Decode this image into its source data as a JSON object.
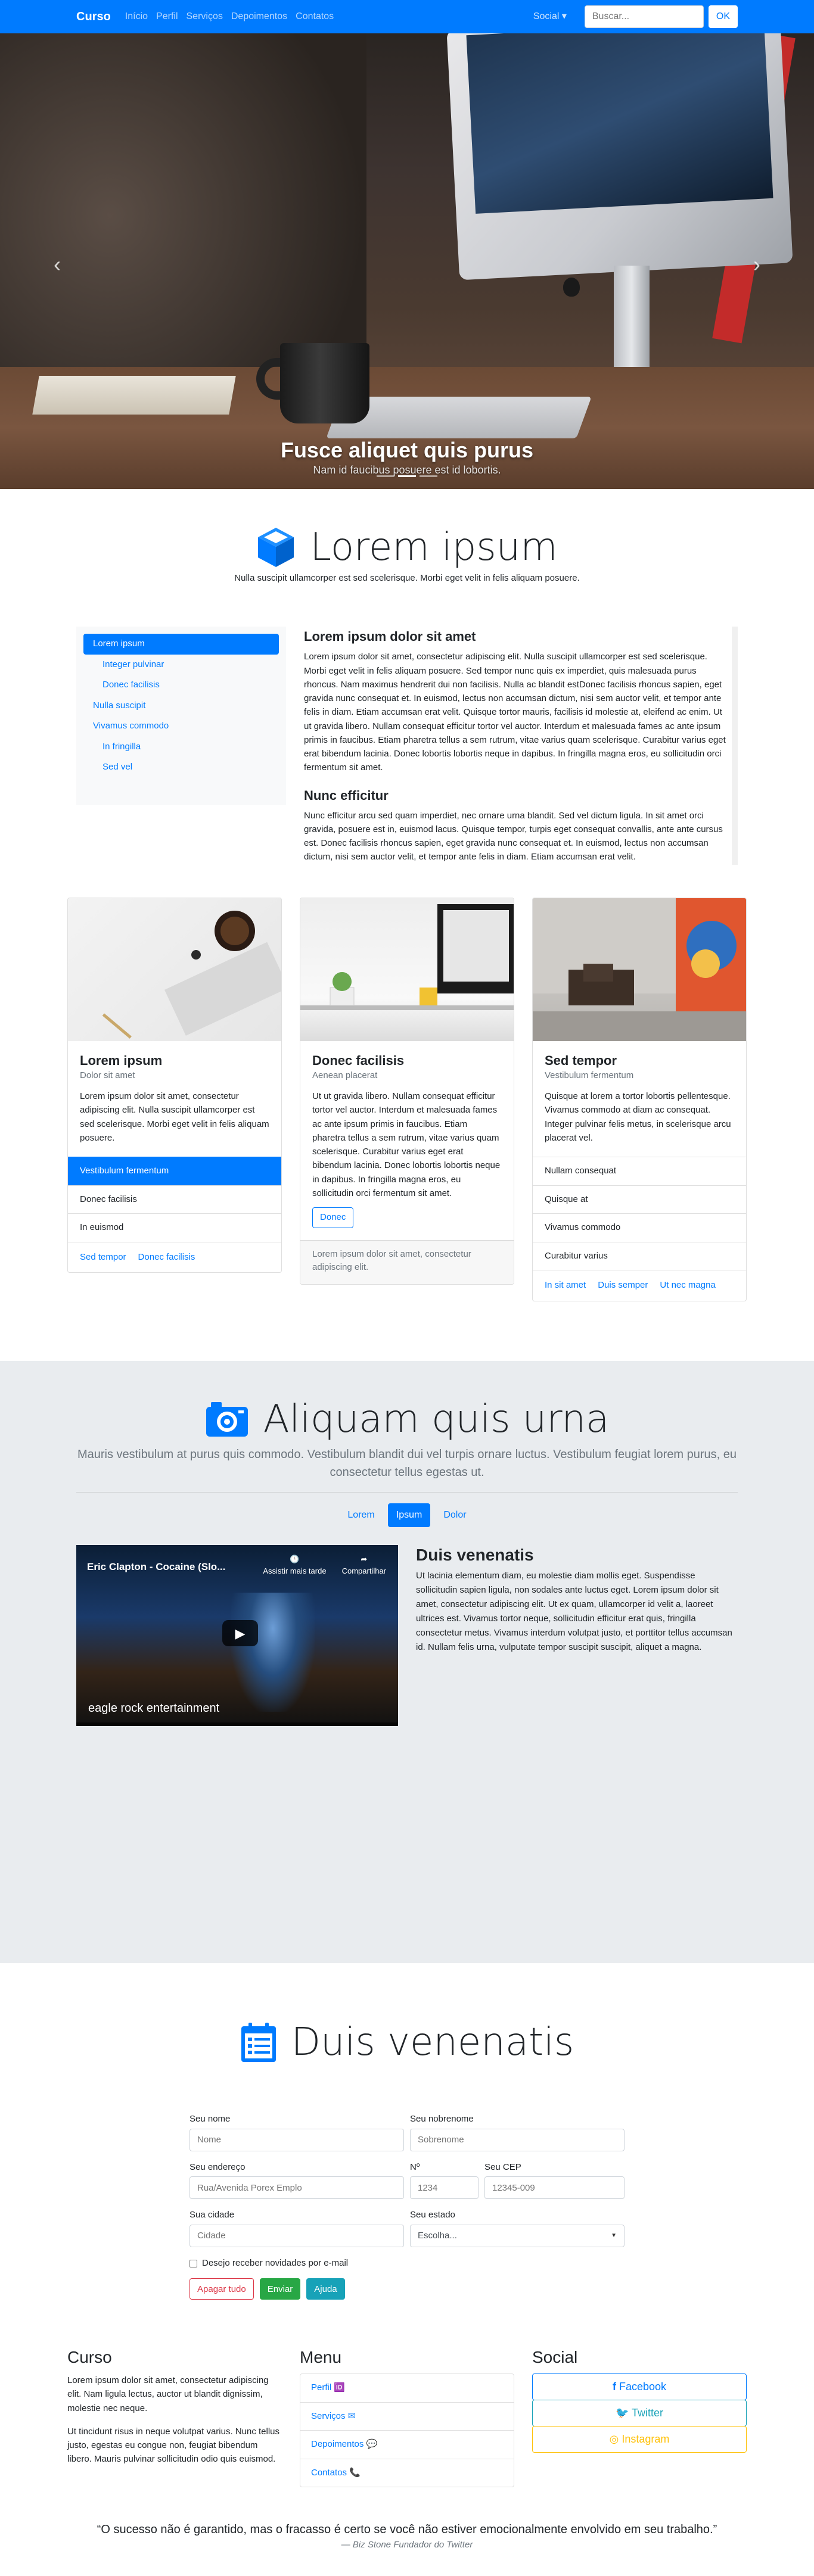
{
  "navbar": {
    "brand": "Curso",
    "links": [
      "Início",
      "Perfil",
      "Serviços",
      "Depoimentos",
      "Contatos"
    ],
    "social": "Social ▾",
    "search_placeholder": "Buscar...",
    "ok": "OK"
  },
  "hero": {
    "title": "Fusce aliquet quis purus",
    "subtitle": "Nam id faucibus posuere est id lobortis."
  },
  "intro": {
    "title": "Lorem ipsum",
    "subtitle": "Nulla suscipit ullamcorper est sed scelerisque. Morbi eget velit in felis aliquam posuere."
  },
  "scrollspy": {
    "nav": [
      {
        "label": "Lorem ipsum",
        "active": true
      },
      {
        "label": "Integer pulvinar",
        "sub": true
      },
      {
        "label": "Donec facilisis",
        "sub": true
      },
      {
        "label": "Nulla suscipit"
      },
      {
        "label": "Vivamus commodo"
      },
      {
        "label": "In fringilla",
        "sub": true
      },
      {
        "label": "Sed vel",
        "sub": true
      }
    ],
    "heading1": "Lorem ipsum dolor sit amet",
    "para1": "Lorem ipsum dolor sit amet, consectetur adipiscing elit. Nulla suscipit ullamcorper est sed scelerisque. Morbi eget velit in felis aliquam posuere. Sed tempor nunc quis ex imperdiet, quis malesuada purus rhoncus. Nam maximus hendrerit dui non facilisis. Nulla ac blandit estDonec facilisis rhoncus sapien, eget gravida nunc consequat et. In euismod, lectus non accumsan dictum, nisi sem auctor velit, et tempor ante felis in diam. Etiam accumsan erat velit. Quisque tortor mauris, facilisis id molestie at, eleifend ac enim. Ut ut gravida libero. Nullam consequat efficitur tortor vel auctor. Interdum et malesuada fames ac ante ipsum primis in faucibus. Etiam pharetra tellus a sem rutrum, vitae varius quam scelerisque. Curabitur varius eget erat bibendum lacinia. Donec lobortis lobortis neque in dapibus. In fringilla magna eros, eu sollicitudin orci fermentum sit amet.",
    "heading2": "Nunc efficitur",
    "para2": "Nunc efficitur arcu sed quam imperdiet, nec ornare urna blandit. Sed vel dictum ligula. In sit amet orci gravida, posuere est in, euismod lacus. Quisque tempor, turpis eget consequat convallis, ante ante cursus est. Donec facilisis rhoncus sapien, eget gravida nunc consequat et. In euismod, lectus non accumsan dictum, nisi sem auctor velit, et tempor ante felis in diam. Etiam accumsan erat velit."
  },
  "cards": [
    {
      "title": "Lorem ipsum",
      "subtitle": "Dolor sit amet",
      "text": "Lorem ipsum dolor sit amet, consectetur adipiscing elit. Nulla suscipit ullamcorper est sed scelerisque. Morbi eget velit in felis aliquam posuere.",
      "list": [
        "Vestibulum fermentum",
        "Donec facilisis",
        "In euismod"
      ],
      "links": [
        "Sed tempor",
        "Donec facilisis"
      ]
    },
    {
      "title": "Donec facilisis",
      "subtitle": "Aenean placerat",
      "text": "Ut ut gravida libero. Nullam consequat efficitur tortor vel auctor. Interdum et malesuada fames ac ante ipsum primis in faucibus. Etiam pharetra tellus a sem rutrum, vitae varius quam scelerisque. Curabitur varius eget erat bibendum lacinia. Donec lobortis lobortis neque in dapibus. In fringilla magna eros, eu sollicitudin orci fermentum sit amet.",
      "button": "Donec",
      "footer": "Lorem ipsum dolor sit amet, consectetur adipiscing elit."
    },
    {
      "title": "Sed tempor",
      "subtitle": "Vestibulum fermentum",
      "text": "Quisque at lorem a tortor lobortis pellentesque. Vivamus commodo at diam ac consequat. Integer pulvinar felis metus, in scelerisque arcu placerat vel.",
      "list": [
        "Nullam consequat",
        "Quisque at",
        "Vivamus commodo",
        "Curabitur varius"
      ],
      "links": [
        "In sit amet",
        "Duis semper",
        "Ut nec magna"
      ]
    }
  ],
  "gallery": {
    "title": "Aliquam quis urna",
    "lead": "Mauris vestibulum at purus quis commodo. Vestibulum blandit dui vel turpis ornare luctus. Vestibulum feugiat lorem purus, eu consectetur tellus egestas ut.",
    "pills": [
      "Lorem",
      "Ipsum",
      "Dolor"
    ],
    "video": {
      "title": "Eric Clapton - Cocaine (Slo...",
      "watch_later": "Assistir mais tarde",
      "share": "Compartilhar",
      "logo": "eagle rock entertainment"
    },
    "media_title": "Duis venenatis",
    "media_text": "Ut lacinia elementum diam, eu molestie diam mollis eget. Suspendisse sollicitudin sapien ligula, non sodales ante luctus eget. Lorem ipsum dolor sit amet, consectetur adipiscing elit. Ut ex quam, ullamcorper id velit a, laoreet ultrices est. Vivamus tortor neque, sollicitudin efficitur erat quis, fringilla consectetur metus. Vivamus interdum volutpat justo, et porttitor tellus accumsan id. Nullam felis urna, vulputate tempor suscipit suscipit, aliquet a magna."
  },
  "form": {
    "title": "Duis venenatis",
    "nome_label": "Seu nome",
    "nome_ph": "Nome",
    "sobrenome_label": "Seu nobrenome",
    "sobrenome_ph": "Sobrenome",
    "endereco_label": "Seu endereço",
    "endereco_ph": "Rua/Avenida Porex Emplo",
    "numero_label": "Nº",
    "numero_ph": "1234",
    "cep_label": "Seu CEP",
    "cep_ph": "12345-009",
    "cidade_label": "Sua cidade",
    "cidade_ph": "Cidade",
    "estado_label": "Seu estado",
    "estado_value": "Escolha...",
    "checkbox_label": "Desejo receber novidades por e-mail",
    "btn_clear": "Apagar tudo",
    "btn_send": "Enviar",
    "btn_help": "Ajuda"
  },
  "footer": {
    "col1_title": "Curso",
    "col1_p1": "Lorem ipsum dolor sit amet, consectetur adipiscing elit. Nam ligula lectus, auctor ut blandit dignissim, molestie nec neque.",
    "col1_p2": "Ut tincidunt risus in neque volutpat varius. Nunc tellus justo, egestas eu congue non, feugiat bibendum libero. Mauris pulvinar sollicitudin odio quis euismod.",
    "menu_title": "Menu",
    "menu": [
      "Perfil",
      "Serviços",
      "Depoimentos",
      "Contatos"
    ],
    "menu_icons": [
      "🆔",
      "✉",
      "💬",
      "📞"
    ],
    "social_title": "Social",
    "facebook": "Facebook",
    "twitter": "Twitter",
    "instagram": "Instagram",
    "facebook_color": "#007bff",
    "twitter_color": "#17a2b8",
    "instagram_color": "#ffc107"
  },
  "quote": {
    "text": "“O sucesso não é garantido, mas o fracasso é certo se você não estiver emocionalmente envolvido em seu trabalho.”",
    "author": "— Biz Stone Fundador do Twitter"
  }
}
